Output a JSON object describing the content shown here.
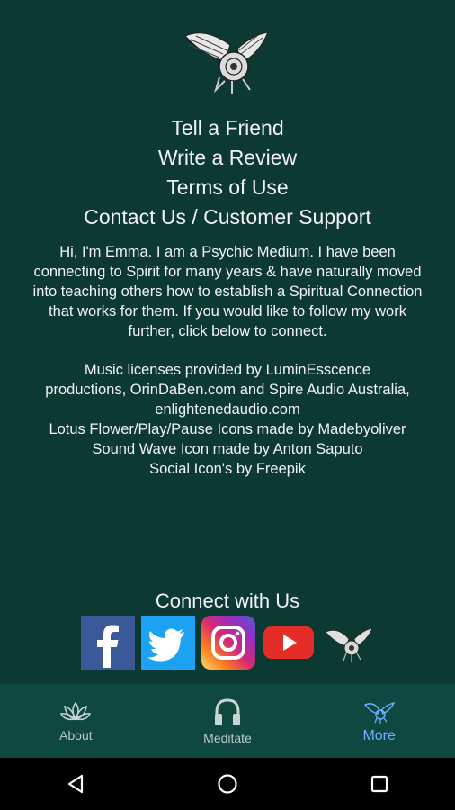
{
  "menu": {
    "items": [
      "Tell a Friend",
      "Write a Review",
      "Terms of Use",
      "Contact Us / Customer Support"
    ]
  },
  "bio": [
    "Hi, I'm Emma. I am a Psychic Medium. I have been",
    "connecting to Spirit for many years & have naturally moved",
    "into teaching others how to establish a Spiritual Connection",
    "that works for them. If you would like to follow my work",
    "further, click below to connect."
  ],
  "credits": [
    "Music licenses provided by LuminEsscence",
    "productions, OrinDaBen.com and Spire Audio Australia,",
    "enlightenedaudio.com",
    "Lotus Flower/Play/Pause Icons made by Madebyoliver",
    "Sound Wave Icon made by Anton Saputo",
    "Social Icon's by Freepik"
  ],
  "connect": {
    "title": "Connect with Us"
  },
  "social": {
    "icons": [
      "facebook-icon",
      "twitter-icon",
      "instagram-icon",
      "youtube-icon",
      "bird-logo-icon"
    ]
  },
  "bottom_nav": {
    "items": [
      {
        "label": "About",
        "icon": "lotus-icon",
        "active": false
      },
      {
        "label": "Meditate",
        "icon": "headphones-icon",
        "active": false
      },
      {
        "label": "More",
        "icon": "bird-icon",
        "active": true
      }
    ]
  },
  "colors": {
    "background": "#0c3a33",
    "nav_background": "#0e4840",
    "active_tab": "#6fb1ff"
  }
}
